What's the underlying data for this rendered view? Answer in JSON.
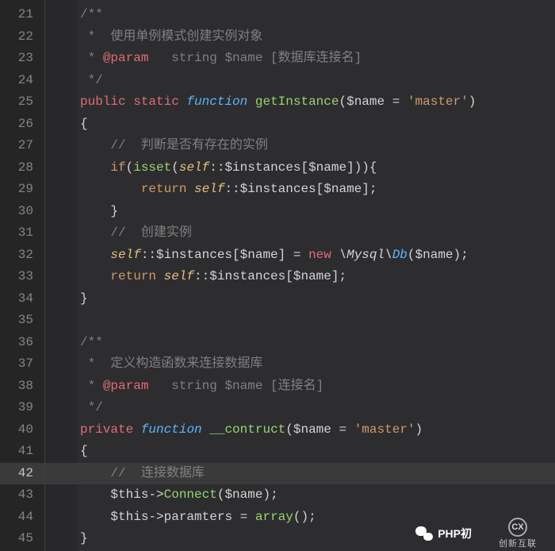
{
  "line_numbers": [
    "21",
    "22",
    "23",
    "24",
    "25",
    "26",
    "27",
    "28",
    "29",
    "30",
    "31",
    "32",
    "33",
    "34",
    "35",
    "36",
    "37",
    "38",
    "39",
    "40",
    "41",
    "42",
    "43",
    "44",
    "45"
  ],
  "current_line_index": 21,
  "code": {
    "l21": "/**",
    "l22_1": " *  ",
    "l22_2": "使用单例模式创建实例对象",
    "l23_1": " * ",
    "l23_2": "@param",
    "l23_3": "   string $name [数据库连接名]",
    "l24": " */",
    "l25_public": "public",
    "l25_static": "static",
    "l25_function": "function",
    "l25_name": "getInstance",
    "l25_var": "$name",
    "l25_eq": " = ",
    "l25_str": "'master'",
    "l26": "{",
    "l27": "//  判断是否有存在的实例",
    "l28_if": "if",
    "l28_isset": "isset",
    "l28_self": "self",
    "l28_inst": "$instances",
    "l28_name": "$name",
    "l29_return": "return",
    "l29_self": "self",
    "l29_inst": "$instances",
    "l29_name": "$name",
    "l30": "}",
    "l31": "//  创建实例",
    "l32_self": "self",
    "l32_inst": "$instances",
    "l32_name": "$name",
    "l32_new": "new",
    "l32_ns": "\\Mysql\\",
    "l32_db": "Db",
    "l32_name2": "$name",
    "l33_return": "return",
    "l33_self": "self",
    "l33_inst": "$instances",
    "l33_name": "$name",
    "l34": "}",
    "l36": "/**",
    "l37_1": " *  ",
    "l37_2": "定义构造函数来连接数据库",
    "l38_1": " * ",
    "l38_2": "@param",
    "l38_3": "   string $name [连接名]",
    "l39": " */",
    "l40_private": "private",
    "l40_function": "function",
    "l40_name": "__contruct",
    "l40_var": "$name",
    "l40_str": "'master'",
    "l41": "{",
    "l42": "//  连接数据库",
    "l43_this": "$this",
    "l43_connect": "Connect",
    "l43_name": "$name",
    "l44_this": "$this",
    "l44_param": "paramters",
    "l44_array": "array",
    "l45": "}"
  },
  "watermark": {
    "wechat_text": "PHP初",
    "logo_inner": "CX",
    "logo_text": "创新互联"
  }
}
